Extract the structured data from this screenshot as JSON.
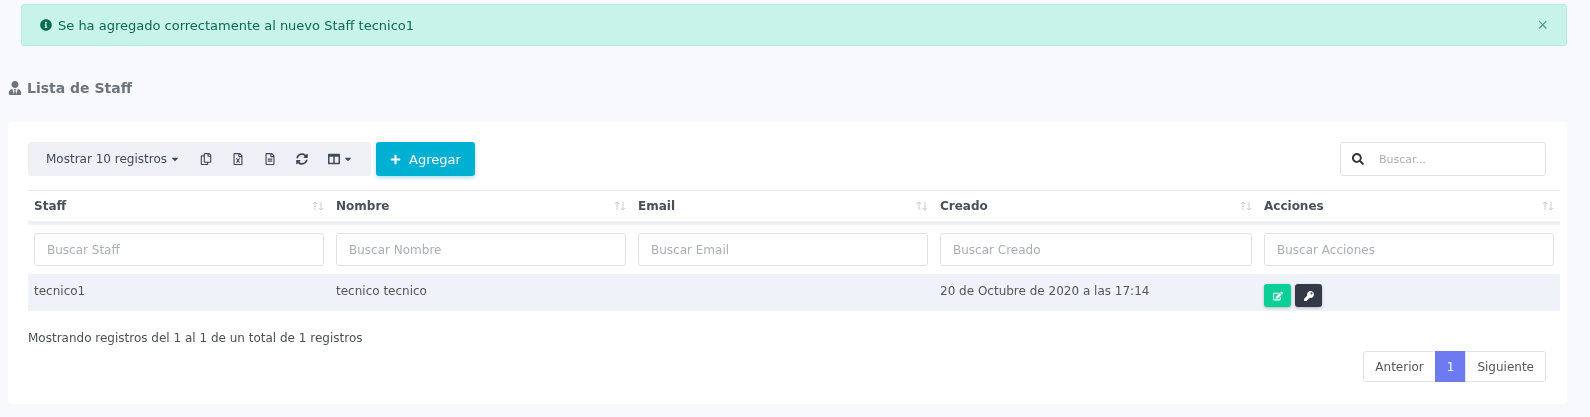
{
  "alert": {
    "text": "Se ha agregado correctamente al nuevo Staff tecnico1",
    "close": "×"
  },
  "heading": "Lista de Staff",
  "toolbar": {
    "length_menu": "Mostrar 10 registros",
    "add_button": "Agregar",
    "search": {
      "placeholder": "Buscar..."
    }
  },
  "table": {
    "columns": [
      {
        "label": "Staff",
        "filter_placeholder": "Buscar Staff"
      },
      {
        "label": "Nombre",
        "filter_placeholder": "Buscar Nombre"
      },
      {
        "label": "Email",
        "filter_placeholder": "Buscar Email"
      },
      {
        "label": "Creado",
        "filter_placeholder": "Buscar Creado"
      },
      {
        "label": "Acciones",
        "filter_placeholder": "Buscar Acciones"
      }
    ],
    "rows": [
      {
        "cells": [
          "tecnico1",
          "tecnico tecnico",
          "",
          "20 de Octubre de 2020 a las 17:14"
        ]
      }
    ]
  },
  "info": "Mostrando registros del 1 al 1 de un total de 1 registros",
  "pagination": [
    {
      "label": "Anterior",
      "selected": false
    },
    {
      "label": "1",
      "selected": true
    },
    {
      "label": "Siguiente",
      "selected": false
    }
  ]
}
